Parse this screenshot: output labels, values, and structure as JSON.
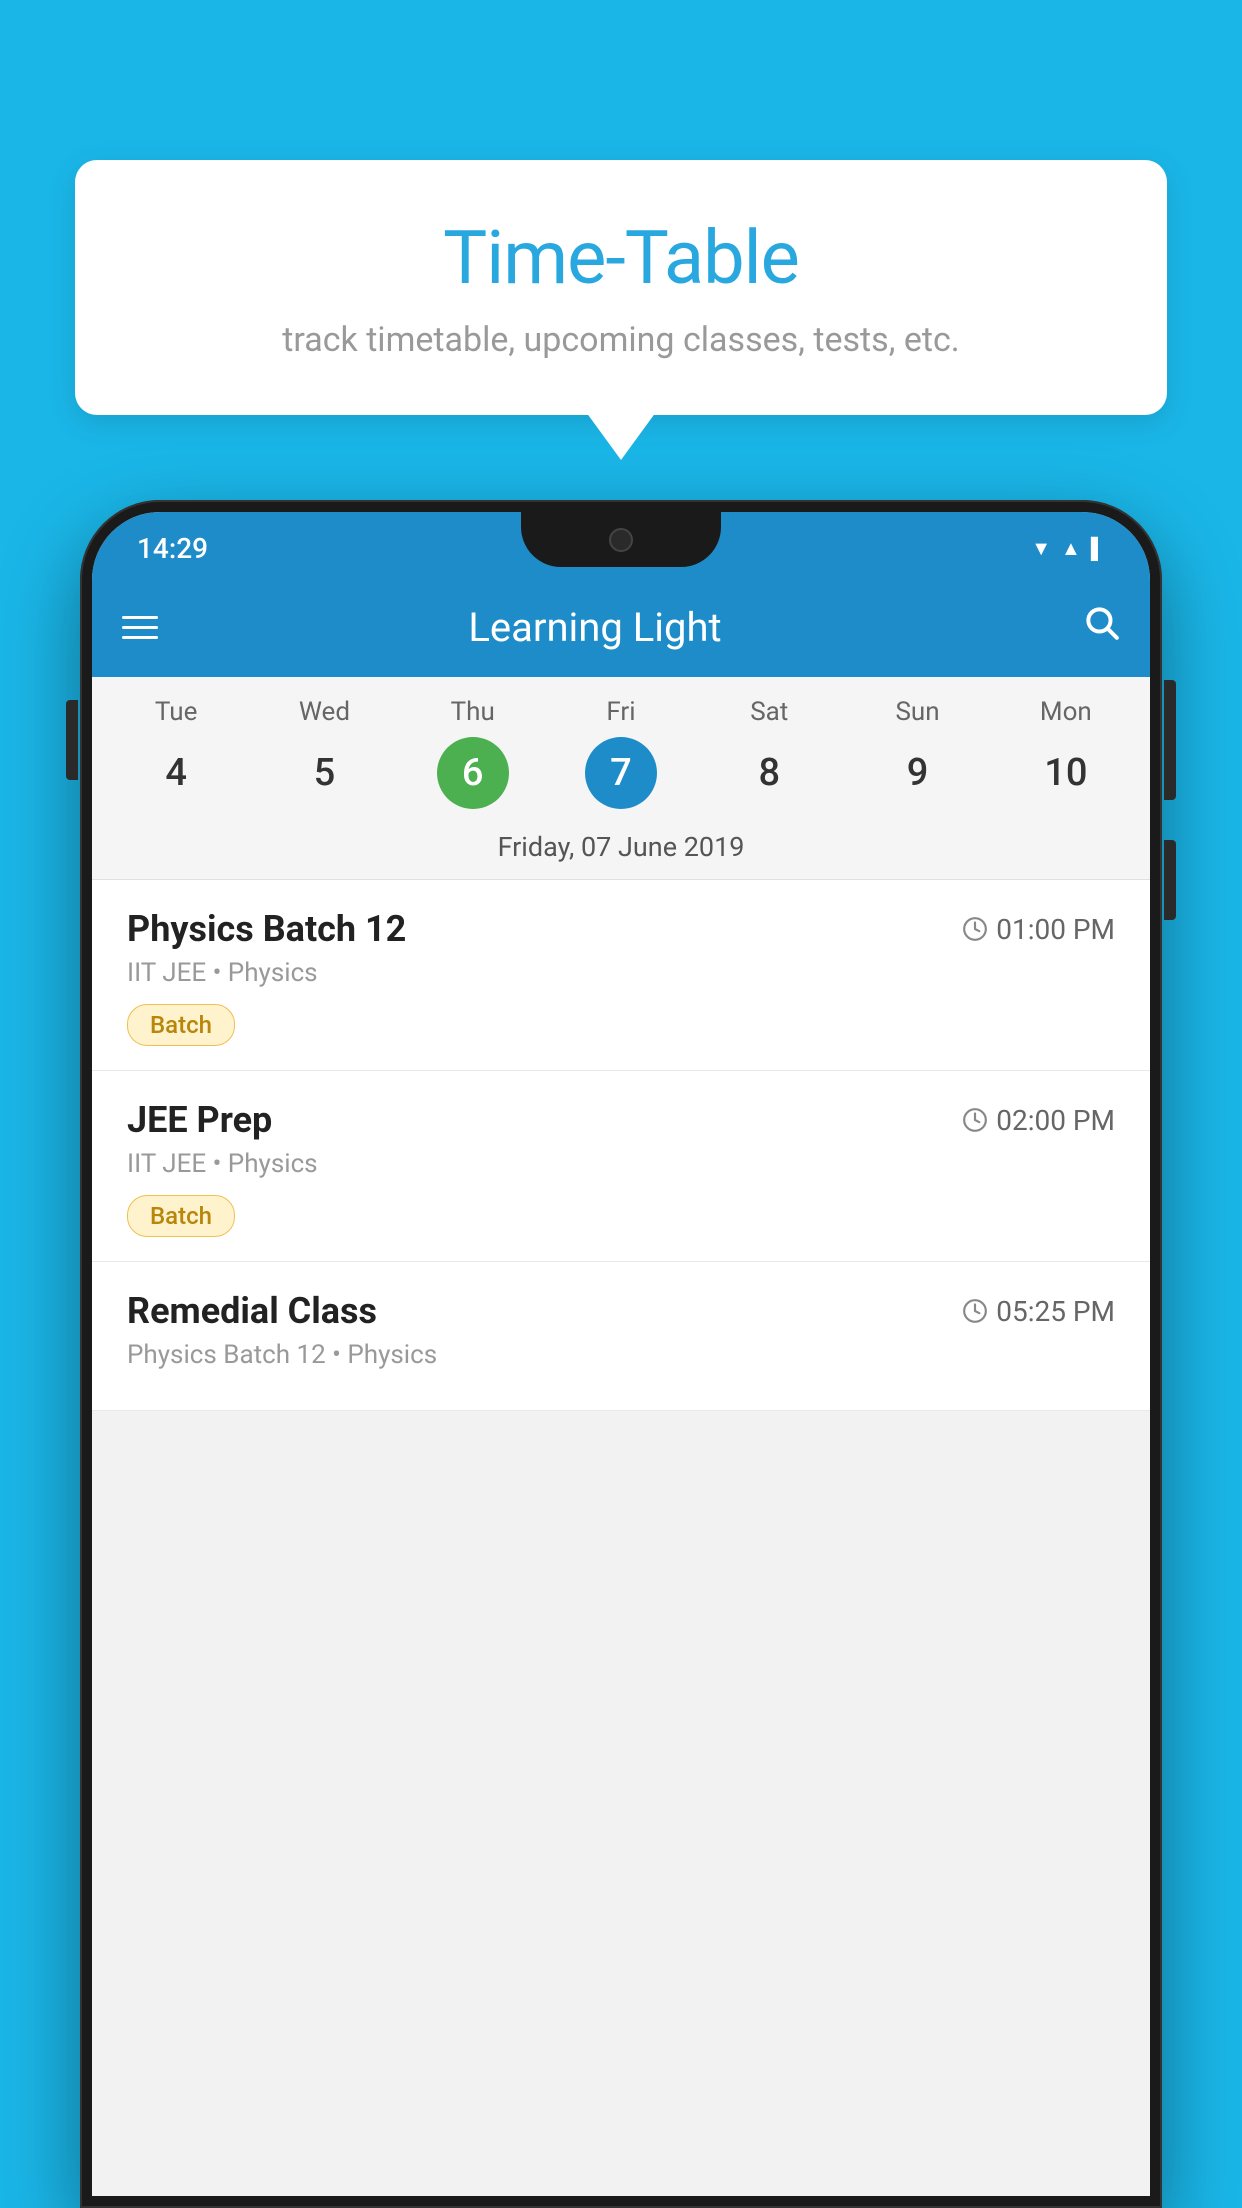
{
  "background_color": "#1ab6e8",
  "tooltip": {
    "title": "Time-Table",
    "subtitle": "track timetable, upcoming classes, tests, etc."
  },
  "phone": {
    "status_bar": {
      "time": "14:29",
      "wifi_icon": "wifi",
      "signal_icon": "signal",
      "battery_icon": "battery"
    },
    "app_bar": {
      "title": "Learning Light",
      "menu_icon": "hamburger-menu",
      "search_icon": "search"
    },
    "calendar": {
      "days": [
        {
          "name": "Tue",
          "num": "4",
          "state": "normal"
        },
        {
          "name": "Wed",
          "num": "5",
          "state": "normal"
        },
        {
          "name": "Thu",
          "num": "6",
          "state": "today"
        },
        {
          "name": "Fri",
          "num": "7",
          "state": "selected"
        },
        {
          "name": "Sat",
          "num": "8",
          "state": "normal"
        },
        {
          "name": "Sun",
          "num": "9",
          "state": "normal"
        },
        {
          "name": "Mon",
          "num": "10",
          "state": "normal"
        }
      ],
      "selected_date_label": "Friday, 07 June 2019"
    },
    "schedule": [
      {
        "title": "Physics Batch 12",
        "time": "01:00 PM",
        "subtitle": "IIT JEE • Physics",
        "badge": "Batch"
      },
      {
        "title": "JEE Prep",
        "time": "02:00 PM",
        "subtitle": "IIT JEE • Physics",
        "badge": "Batch"
      },
      {
        "title": "Remedial Class",
        "time": "05:25 PM",
        "subtitle": "Physics Batch 12 • Physics",
        "badge": null
      }
    ]
  }
}
